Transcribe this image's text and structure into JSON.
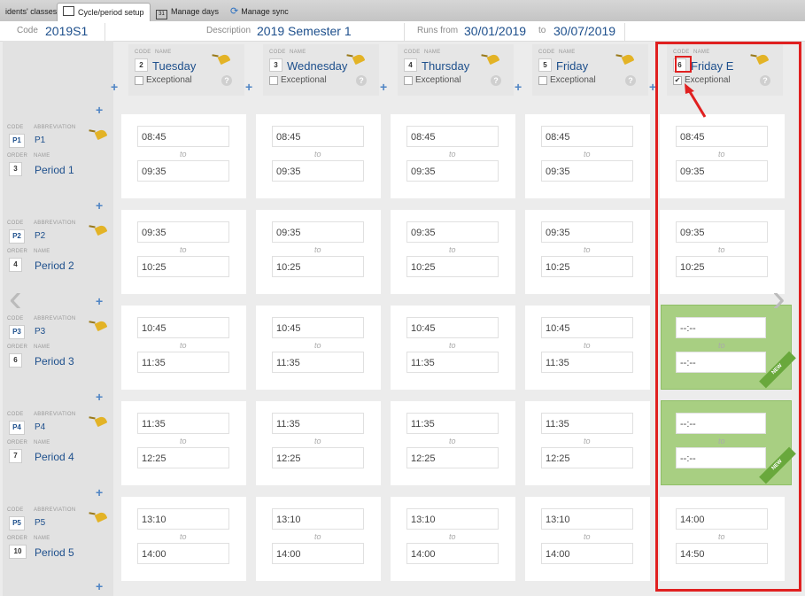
{
  "tabs": [
    {
      "label": "idents' classes"
    },
    {
      "label": "Cycle/period setup",
      "icon": "calendar-icon",
      "active": true
    },
    {
      "label": "Manage days",
      "icon": "calendar-31-icon",
      "icon_text": "31"
    },
    {
      "label": "Manage sync",
      "icon": "sync-icon"
    }
  ],
  "header": {
    "code_label": "Code",
    "code_value": "2019S1",
    "description_label": "Description",
    "description_value": "2019 Semester 1",
    "runs_label": "Runs from",
    "runs_from": "30/01/2019",
    "to_label": "to",
    "runs_to": "30/07/2019"
  },
  "labels": {
    "code": "CODE",
    "name": "NAME",
    "abbreviation": "ABBREVIATION",
    "order": "ORDER",
    "exceptional": "Exceptional",
    "to": "to",
    "help": "?",
    "new": "NEW"
  },
  "days": [
    {
      "code": "2",
      "name": "Tuesday",
      "exceptional": false
    },
    {
      "code": "3",
      "name": "Wednesday",
      "exceptional": false
    },
    {
      "code": "4",
      "name": "Thursday",
      "exceptional": false
    },
    {
      "code": "5",
      "name": "Friday",
      "exceptional": false
    },
    {
      "code": "6",
      "name": "Friday E",
      "exceptional": true
    }
  ],
  "periods": [
    {
      "code": "P1",
      "abbreviation": "P1",
      "order": "3",
      "name": "Period 1"
    },
    {
      "code": "P2",
      "abbreviation": "P2",
      "order": "4",
      "name": "Period 2"
    },
    {
      "code": "P3",
      "abbreviation": "P3",
      "order": "6",
      "name": "Period 3"
    },
    {
      "code": "P4",
      "abbreviation": "P4",
      "order": "7",
      "name": "Period 4"
    },
    {
      "code": "P5",
      "abbreviation": "P5",
      "order": "10",
      "name": "Period 5"
    }
  ],
  "times": [
    [
      {
        "start": "08:45",
        "end": "09:35"
      },
      {
        "start": "08:45",
        "end": "09:35"
      },
      {
        "start": "08:45",
        "end": "09:35"
      },
      {
        "start": "08:45",
        "end": "09:35"
      },
      {
        "start": "08:45",
        "end": "09:35"
      }
    ],
    [
      {
        "start": "09:35",
        "end": "10:25"
      },
      {
        "start": "09:35",
        "end": "10:25"
      },
      {
        "start": "09:35",
        "end": "10:25"
      },
      {
        "start": "09:35",
        "end": "10:25"
      },
      {
        "start": "09:35",
        "end": "10:25"
      }
    ],
    [
      {
        "start": "10:45",
        "end": "11:35"
      },
      {
        "start": "10:45",
        "end": "11:35"
      },
      {
        "start": "10:45",
        "end": "11:35"
      },
      {
        "start": "10:45",
        "end": "11:35"
      },
      {
        "start": "--:--",
        "end": "--:--",
        "new": true
      }
    ],
    [
      {
        "start": "11:35",
        "end": "12:25"
      },
      {
        "start": "11:35",
        "end": "12:25"
      },
      {
        "start": "11:35",
        "end": "12:25"
      },
      {
        "start": "11:35",
        "end": "12:25"
      },
      {
        "start": "--:--",
        "end": "--:--",
        "new": true
      }
    ],
    [
      {
        "start": "13:10",
        "end": "14:00"
      },
      {
        "start": "13:10",
        "end": "14:00"
      },
      {
        "start": "13:10",
        "end": "14:00"
      },
      {
        "start": "13:10",
        "end": "14:00"
      },
      {
        "start": "14:00",
        "end": "14:50"
      }
    ]
  ],
  "colors": {
    "accent": "#1d4f8c",
    "highlight": "#e02020",
    "new_cell": "#a8cf82"
  }
}
